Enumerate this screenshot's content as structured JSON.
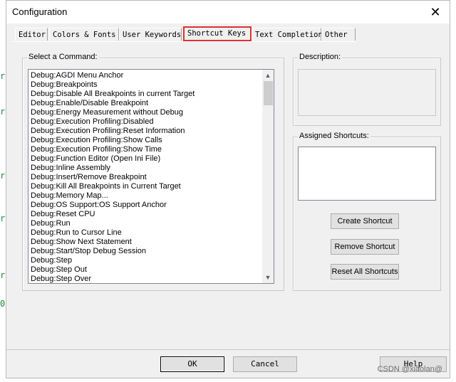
{
  "window": {
    "title": "Configuration"
  },
  "tabs": [
    {
      "label": "Editor",
      "active": false
    },
    {
      "label": "Colors & Fonts",
      "active": false
    },
    {
      "label": "User Keywords",
      "active": false
    },
    {
      "label": "Shortcut Keys",
      "active": true
    },
    {
      "label": "Text Completion",
      "active": false
    },
    {
      "label": "Other",
      "active": false
    }
  ],
  "commands": {
    "label": "Select a Command:",
    "items": [
      "Debug:AGDI Menu Anchor",
      "Debug:Breakpoints",
      "Debug:Disable All Breakpoints in current Target",
      "Debug:Enable/Disable Breakpoint",
      "Debug:Energy Measurement without Debug",
      "Debug:Execution Profiling:Disabled",
      "Debug:Execution Profiling:Reset Information",
      "Debug:Execution Profiling:Show Calls",
      "Debug:Execution Profiling:Show Time",
      "Debug:Function Editor (Open Ini File)",
      "Debug:Inline Assembly",
      "Debug:Insert/Remove Breakpoint",
      "Debug:Kill All Breakpoints in Current Target",
      "Debug:Memory Map...",
      "Debug:OS Support:OS Support Anchor",
      "Debug:Reset CPU",
      "Debug:Run",
      "Debug:Run to Cursor Line",
      "Debug:Show Next Statement",
      "Debug:Start/Stop Debug Session",
      "Debug:Step",
      "Debug:Step Out",
      "Debug:Step Over"
    ]
  },
  "description": {
    "label": "Description:"
  },
  "assigned": {
    "label": "Assigned Shortcuts:"
  },
  "buttons": {
    "create": "Create Shortcut",
    "remove": "Remove Shortcut",
    "reset": "Reset All Shortcuts",
    "ok": "OK",
    "cancel": "Cancel",
    "help": "Help"
  },
  "icons": {
    "close": "close-icon",
    "scroll_up": "chevron-up-icon",
    "scroll_down": "chevron-down-icon"
  },
  "watermark": "CSDN @xiaolan@",
  "colors": {
    "highlight_border": "#e03030",
    "dialog_bg": "#f0f0f0"
  }
}
